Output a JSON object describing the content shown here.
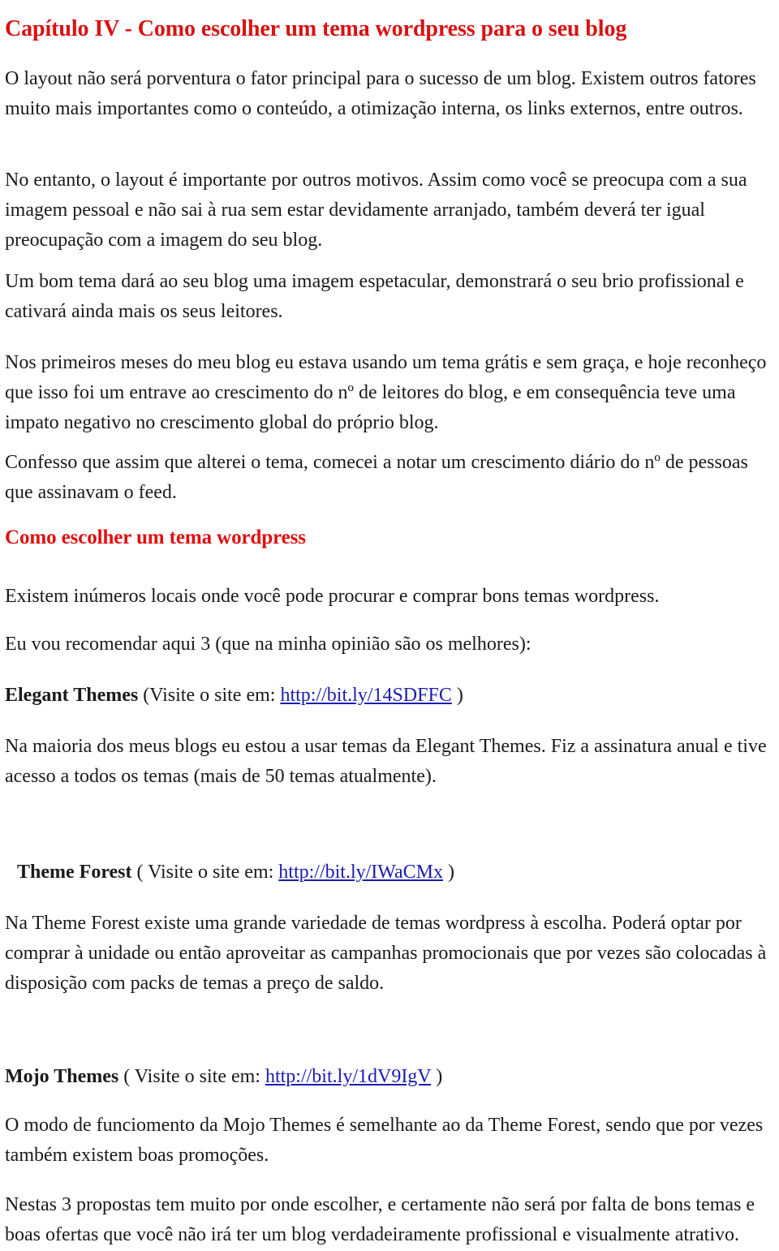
{
  "document": {
    "chapter_heading": "Capítulo IV - Como escolher um tema wordpress para o seu blog",
    "section_heading": "Como escolher um tema wordpress",
    "paragraphs": {
      "p1": "O layout não será porventura o fator principal para o sucesso de um blog. Existem outros fatores muito mais importantes como o conteúdo, a otimização interna, os links externos, entre outros.",
      "p2": "No entanto, o layout é importante por outros motivos. Assim como você se preocupa com a sua imagem pessoal e não sai à rua sem estar devidamente arranjado, também deverá ter igual preocupação com a imagem do seu blog.",
      "p3": "Um bom tema dará ao seu blog uma imagem espetacular, demonstrará o seu brio profissional e cativará ainda mais os seus leitores.",
      "p4": "Nos primeiros meses do meu blog eu estava usando um tema grátis e sem graça, e hoje reconheço que isso foi um entrave ao crescimento do nº de leitores do blog, e em consequência teve uma impato negativo no crescimento global do próprio blog.",
      "p5": "Confesso que assim que alterei o tema, comecei a notar um crescimento diário do nº de pessoas que assinavam o feed.",
      "p6": "Existem inúmeros locais onde você pode procurar e comprar bons temas wordpress.",
      "p7": "Eu vou recomendar aqui 3 (que na minha opinião são os melhores):",
      "p8": "Na maioria dos meus blogs eu estou a usar temas da Elegant Themes. Fiz a assinatura anual e tive acesso a todos os temas (mais de 50 temas atualmente).",
      "p9": "Na Theme Forest existe uma grande variedade de temas wordpress à escolha. Poderá optar por comprar à unidade ou então aproveitar as campanhas promocionais que por vezes são colocadas à disposição com packs de temas a preço de saldo.",
      "p10": "O modo de funciomento da Mojo Themes é semelhante ao da Theme Forest, sendo que por vezes também existem boas promoções.",
      "p11": "Nestas 3 propostas tem muito por onde escolher, e certamente não será por falta de bons temas e boas ofertas que você não irá ter um blog verdadeiramente profissional e visualmente atrativo."
    },
    "resources": [
      {
        "name": "Elegant Themes",
        "prefix": " (Visite o site em: ",
        "url": "http://bit.ly/14SDFFC",
        "suffix": " )"
      },
      {
        "name": "Theme Forest",
        "prefix": " ( Visite o site em: ",
        "url": "http://bit.ly/IWaCMx",
        "suffix": " )"
      },
      {
        "name": "Mojo Themes",
        "prefix": " ( Visite o site em: ",
        "url": "http://bit.ly/1dV9IgV",
        "suffix": " )"
      }
    ],
    "colors": {
      "heading_red": "#d81212",
      "link_blue": "#1c1cb0",
      "body_text": "#1a1a1a",
      "background": "#ffffff"
    }
  }
}
